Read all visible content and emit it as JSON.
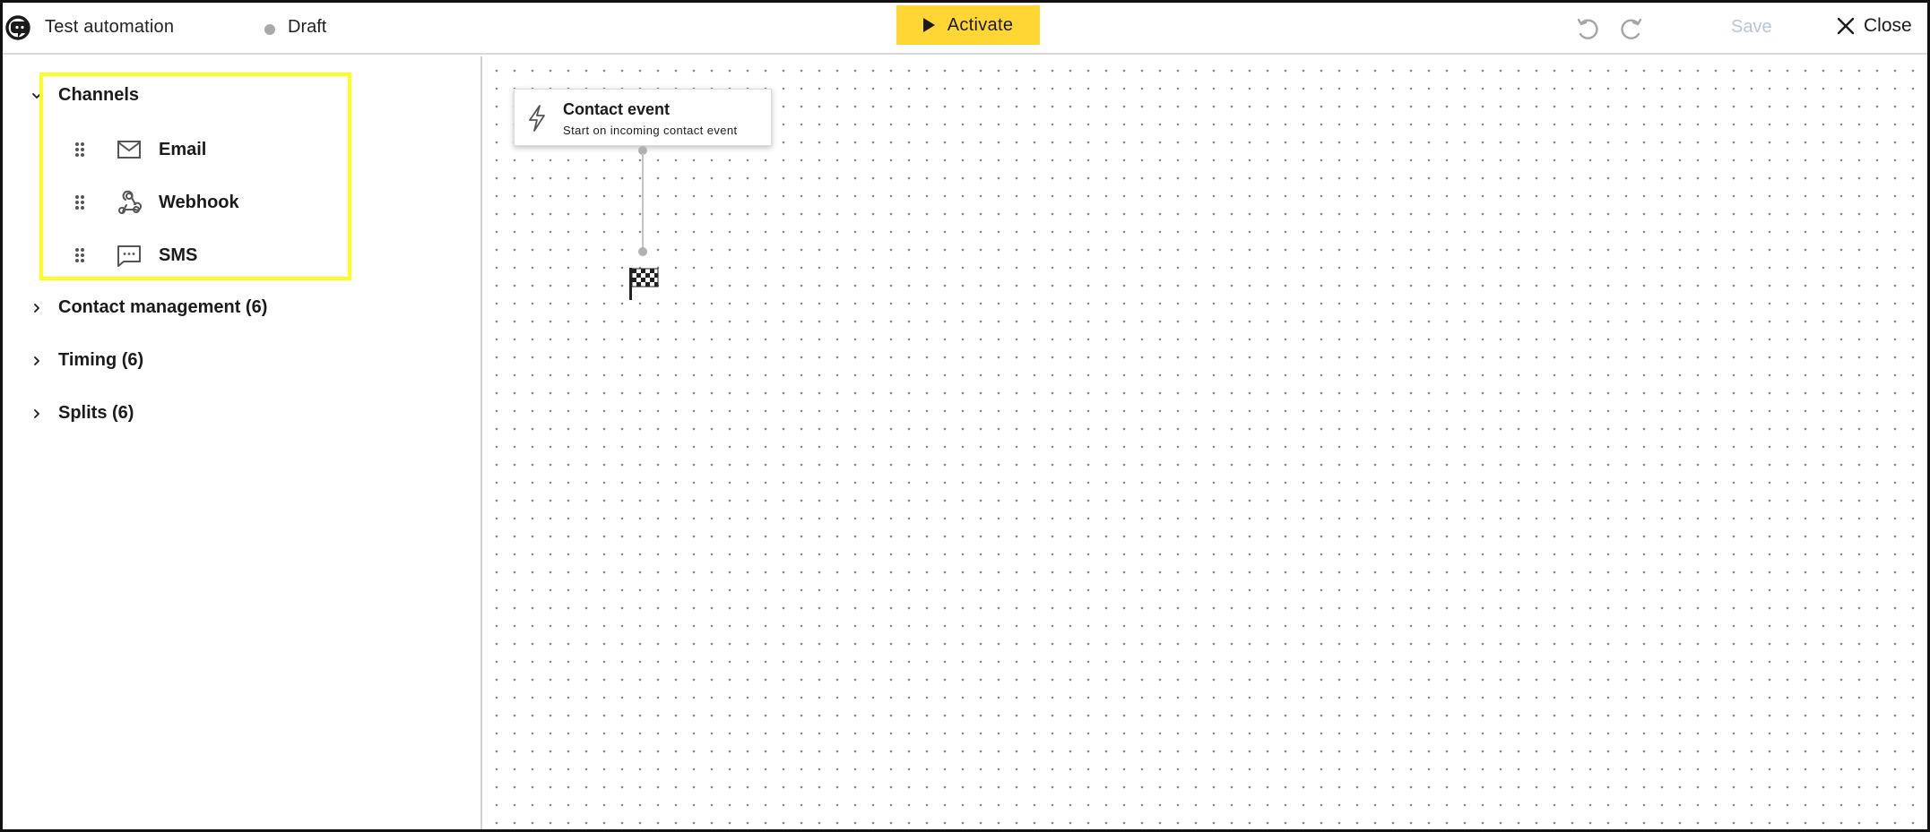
{
  "header": {
    "title": "Test automation",
    "status": "Draft",
    "activate_label": "Activate",
    "save_label": "Save",
    "close_label": "Close",
    "colors": {
      "activate_bg": "#ffd633",
      "save_disabled": "#b9c7d4",
      "status_dot": "#a9a9a9"
    }
  },
  "sidebar": {
    "groups": [
      {
        "label": "Channels",
        "expanded": true,
        "items": [
          {
            "label": "Email",
            "icon": "envelope-icon"
          },
          {
            "label": "Webhook",
            "icon": "webhook-icon"
          },
          {
            "label": "SMS",
            "icon": "chat-bubble-icon"
          }
        ]
      },
      {
        "label": "Contact management (6)",
        "expanded": false
      },
      {
        "label": "Timing (6)",
        "expanded": false
      },
      {
        "label": "Splits (6)",
        "expanded": false
      }
    ],
    "highlight_color": "#ffff1f"
  },
  "canvas": {
    "trigger": {
      "title": "Contact event",
      "subtitle": "Start on incoming contact event",
      "icon": "lightning-bolt-icon"
    },
    "end_icon": "checkered-flag-icon"
  }
}
